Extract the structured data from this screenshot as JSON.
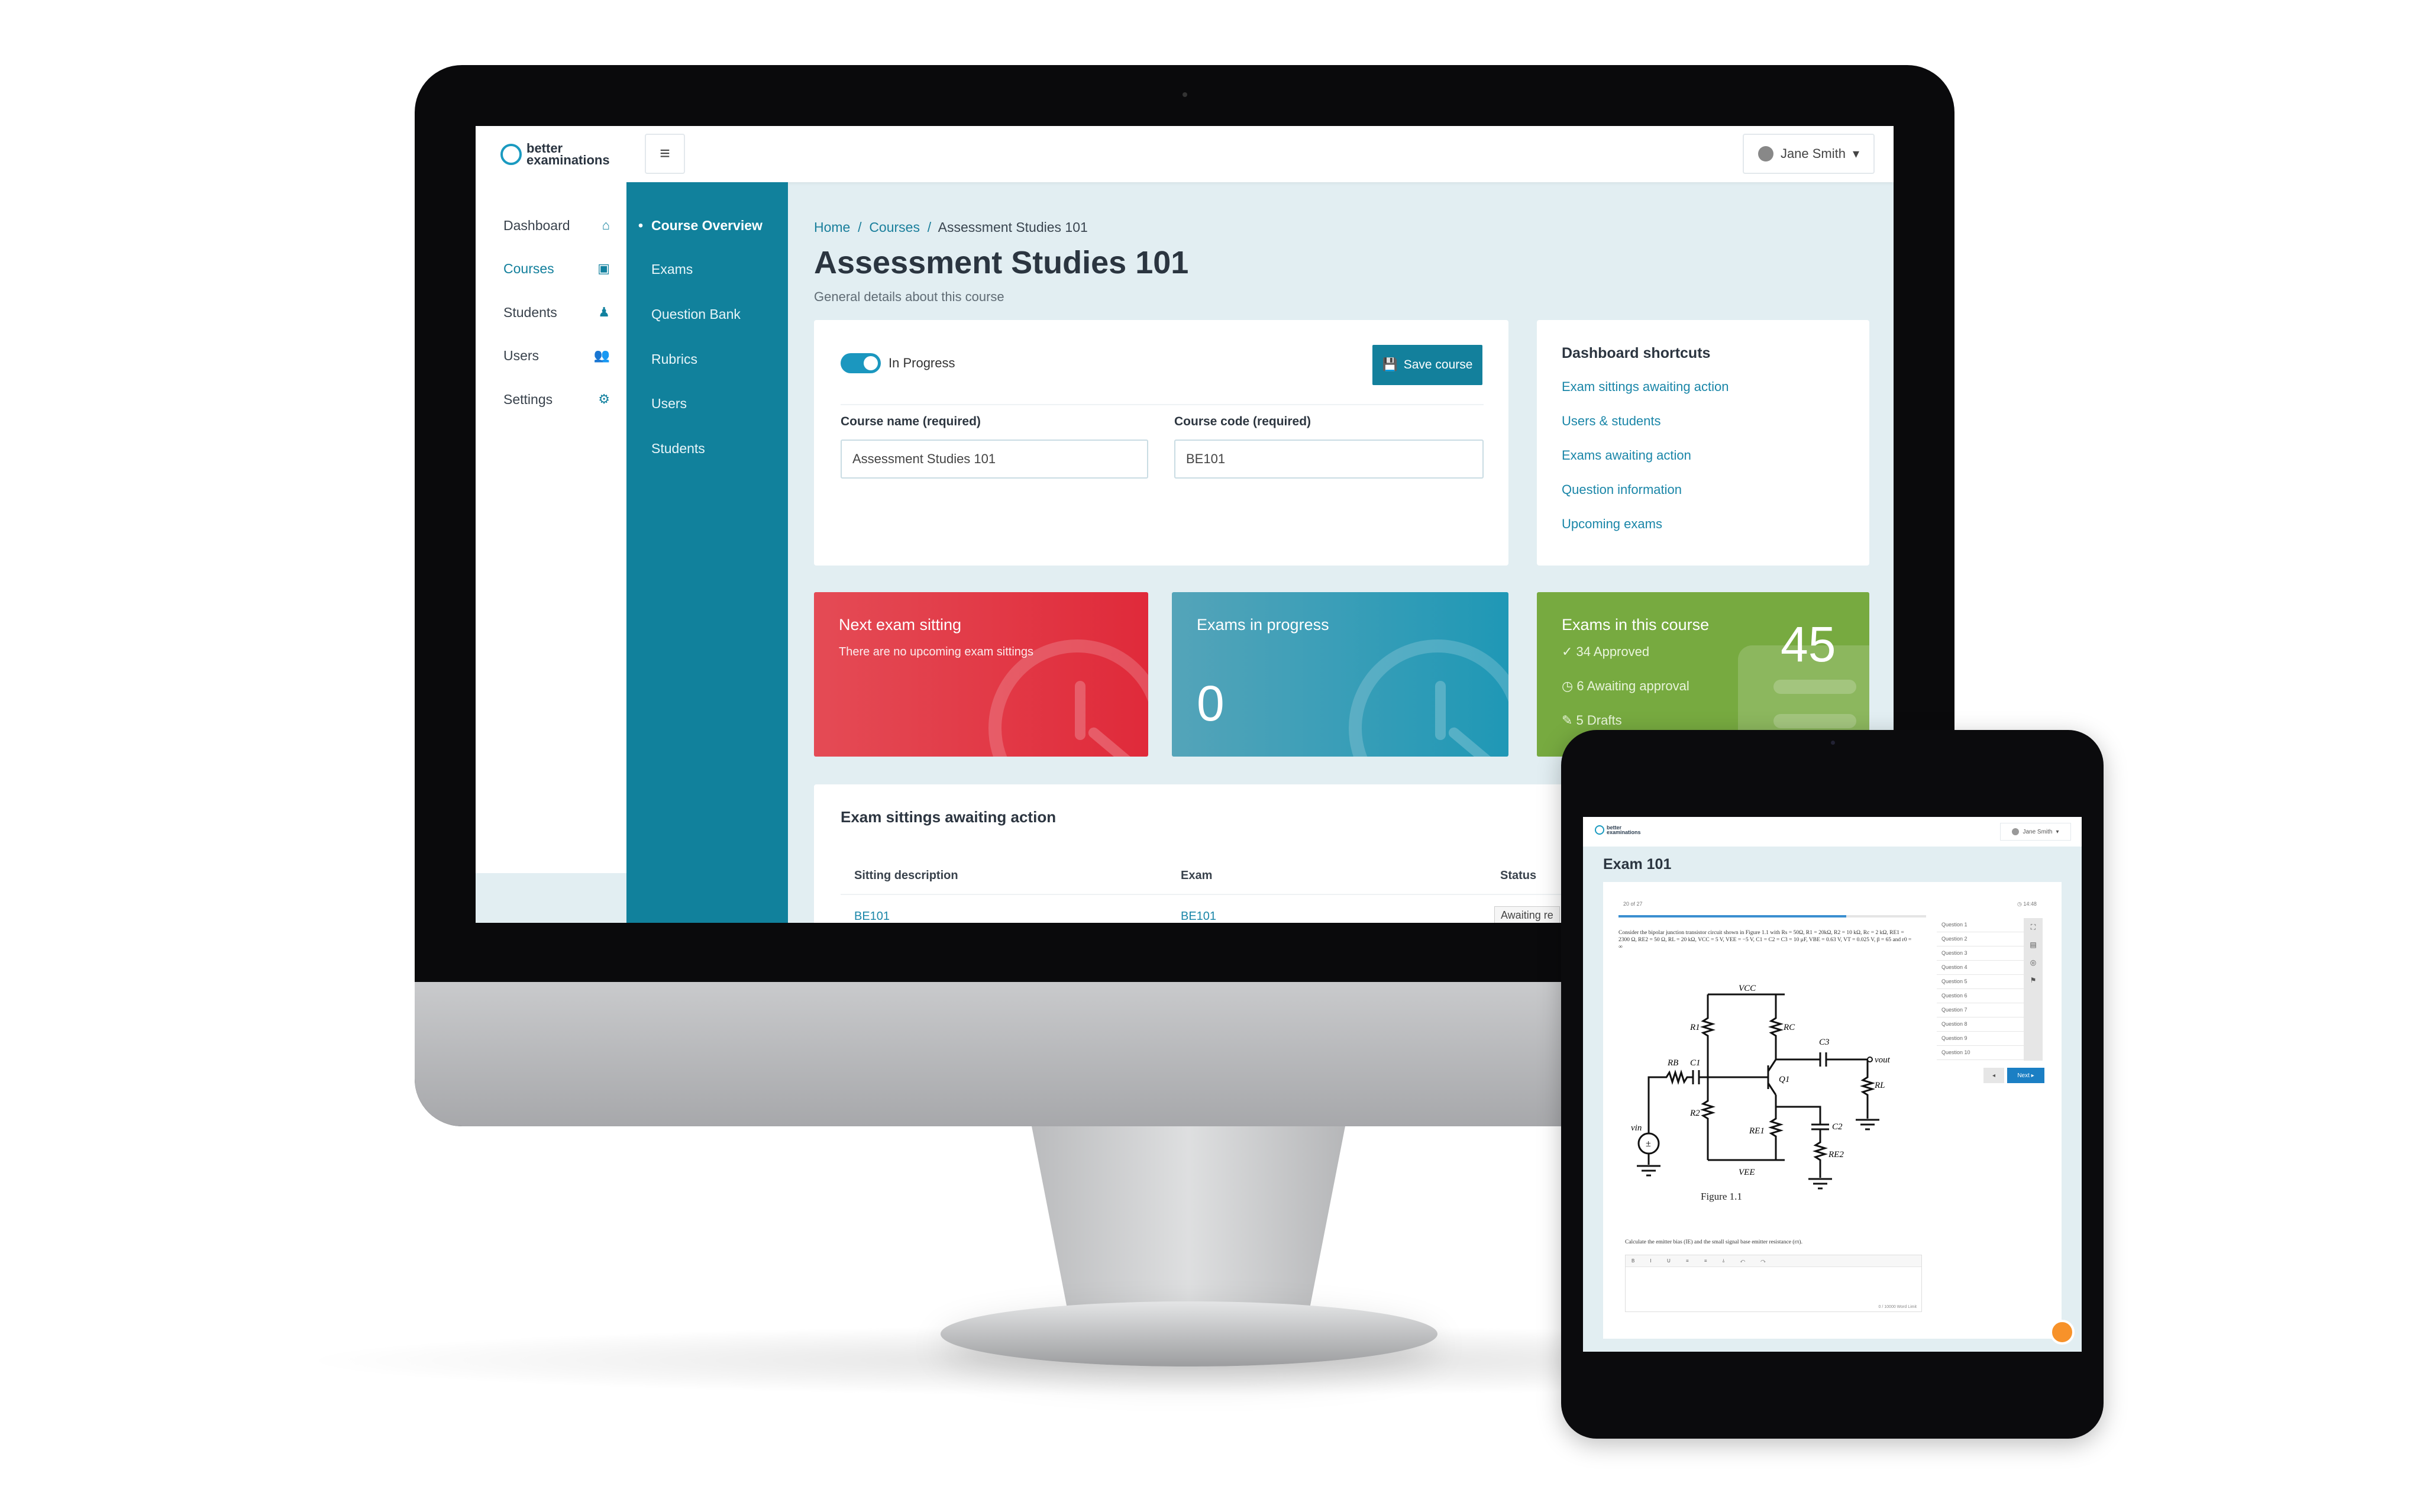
{
  "header": {
    "logo_top": "better",
    "logo_bottom": "examinations",
    "menu_icon": "hamburger-icon",
    "user_name": "Jane Smith"
  },
  "sidebar": {
    "items": [
      {
        "label": "Dashboard",
        "icon": "home-icon",
        "glyph": "⌂"
      },
      {
        "label": "Courses",
        "icon": "book-icon",
        "glyph": "▣"
      },
      {
        "label": "Students",
        "icon": "student-icon",
        "glyph": "♟"
      },
      {
        "label": "Users",
        "icon": "users-icon",
        "glyph": "👥"
      },
      {
        "label": "Settings",
        "icon": "gear-icon",
        "glyph": "⚙"
      }
    ],
    "active": "Courses"
  },
  "subnav": {
    "items": [
      "Course Overview",
      "Exams",
      "Question Bank",
      "Rubrics",
      "Users",
      "Students"
    ],
    "active": "Course Overview"
  },
  "breadcrumb": [
    "Home",
    "Courses",
    "Assessment Studies 101"
  ],
  "page": {
    "title": "Assessment Studies 101",
    "subtitle": "General details about this course"
  },
  "course_form": {
    "status_label": "In Progress",
    "status_on": true,
    "save_label": "Save course",
    "name_label": "Course name (required)",
    "name_value": "Assessment Studies 101",
    "code_label": "Course code (required)",
    "code_value": "BE101"
  },
  "shortcuts": {
    "title": "Dashboard shortcuts",
    "links": [
      "Exam sittings awaiting action",
      "Users & students",
      "Exams awaiting action",
      "Question information",
      "Upcoming exams"
    ]
  },
  "stats": {
    "next_sitting": {
      "title": "Next exam sitting",
      "text": "There are no upcoming exam sittings",
      "color": "#e2303f"
    },
    "in_progress": {
      "title": "Exams in progress",
      "value": "0",
      "color": "#2a9ab6"
    },
    "in_course": {
      "title": "Exams in this course",
      "value": "45",
      "approved": "34 Approved",
      "awaiting": "6 Awaiting approval",
      "drafts": "5 Drafts",
      "color": "#77aa40"
    }
  },
  "sittings_table": {
    "title": "Exam sittings awaiting action",
    "columns": [
      "Sitting description",
      "Exam",
      "Status"
    ],
    "rows": [
      [
        "BE101",
        "BE101",
        "Awaiting re"
      ]
    ]
  },
  "tablet": {
    "logo_top": "better",
    "logo_bottom": "examinations",
    "user_name": "Jane Smith",
    "title": "Exam 101",
    "progress_label": "20 of 27",
    "progress": 0.74,
    "timer": "14:48",
    "question_text": "Consider the bipolar junction transistor circuit shown in Figure 1.1 with Rs = 50Ω, R1 = 20kΩ, R2 = 10 kΩ, Rc = 2 kΩ, RE1 = 2300 Ω, RE2 = 50 Ω, RL = 20 kΩ, VCC = 5 V, VEE = −5 V, C1 = C2 = C3 = 10 μF, VBE = 0.63 V, VT = 0.025 V, β = 65 and r0 = ∞",
    "figure_caption": "Figure 1.1",
    "circuit_labels": {
      "vcc": "VCC",
      "vee": "VEE",
      "r1": "R1",
      "r2": "R2",
      "rc": "RC",
      "rb": "RB",
      "c1": "C1",
      "c2": "C2",
      "c3": "C3",
      "q1": "Q1",
      "rl": "RL",
      "re1": "RE1",
      "re2": "RE2",
      "vin": "vin",
      "vout": "vout"
    },
    "prompt": "Calculate the emitter bias (IE) and the small signal base emitter resistance (rπ).",
    "editor_tools": "B I U ≡ ≡ ⫰ ↶ ↷",
    "word_limit": "0 / 10000 Word Limit",
    "questions": [
      "Question 1",
      "Question 2",
      "Question 3",
      "Question 4",
      "Question 5",
      "Question 6",
      "Question 7",
      "Question 8",
      "Question 9",
      "Question 10"
    ],
    "prev_label": "◂",
    "next_label": "Next ▸"
  }
}
